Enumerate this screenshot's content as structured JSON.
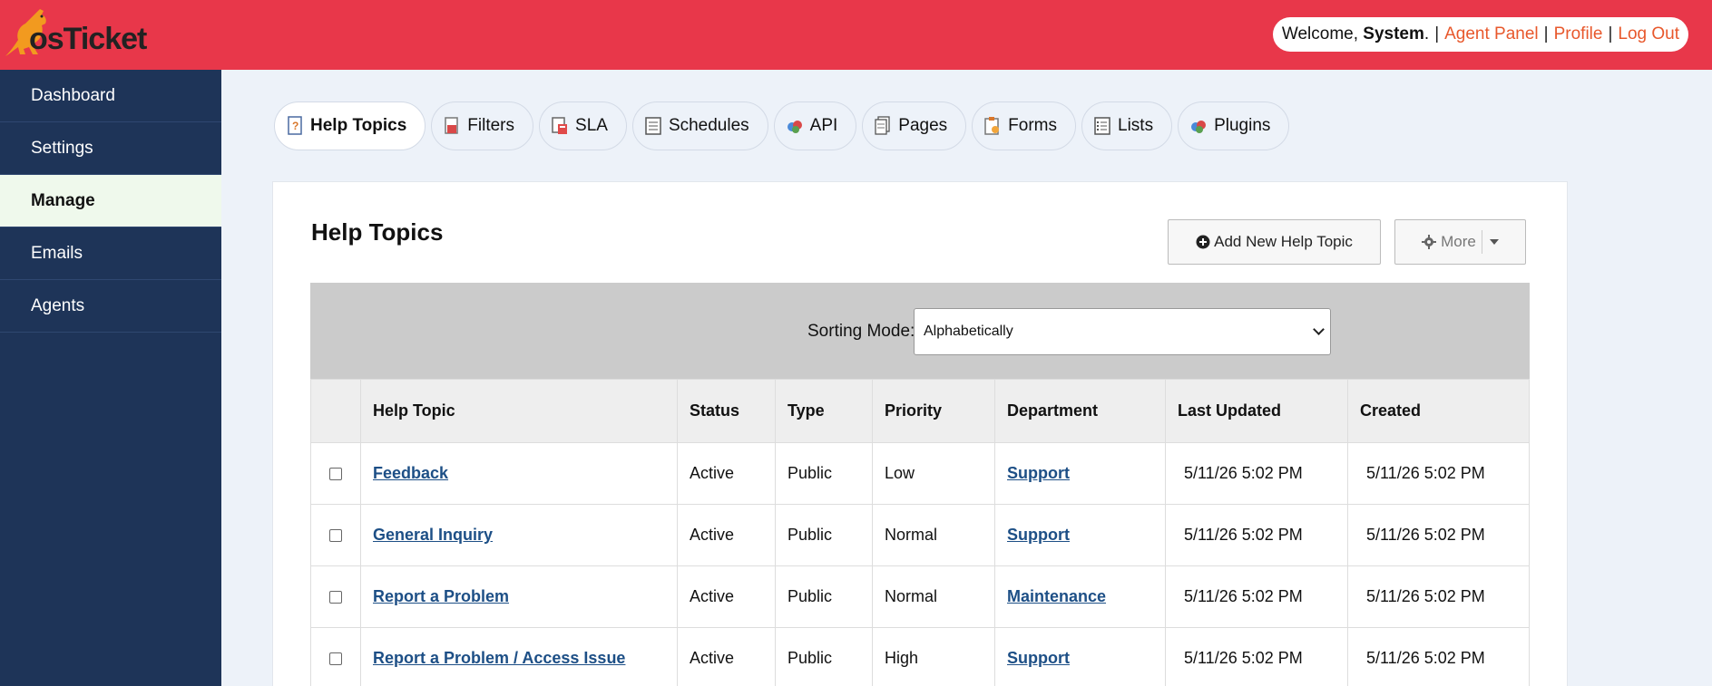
{
  "app": {
    "logo_text": "osTicket"
  },
  "header": {
    "welcome_prefix": "Welcome,",
    "user": "System",
    "welcome_suffix": ".",
    "sep": "|",
    "links": [
      "Agent Panel",
      "Profile",
      "Log Out"
    ]
  },
  "sidebar": {
    "items": [
      {
        "label": "Dashboard"
      },
      {
        "label": "Settings"
      },
      {
        "label": "Manage",
        "active": true
      },
      {
        "label": "Emails"
      },
      {
        "label": "Agents"
      }
    ]
  },
  "tabs": [
    {
      "label": "Help Topics",
      "icon": "help-topics-icon",
      "active": true
    },
    {
      "label": "Filters",
      "icon": "filters-icon"
    },
    {
      "label": "SLA",
      "icon": "sla-icon"
    },
    {
      "label": "Schedules",
      "icon": "schedules-icon"
    },
    {
      "label": "API",
      "icon": "api-icon"
    },
    {
      "label": "Pages",
      "icon": "pages-icon"
    },
    {
      "label": "Forms",
      "icon": "forms-icon"
    },
    {
      "label": "Lists",
      "icon": "lists-icon"
    },
    {
      "label": "Plugins",
      "icon": "plugins-icon"
    }
  ],
  "main": {
    "title": "Help Topics",
    "add_button": "Add New Help Topic",
    "more_button": "More",
    "sorting": {
      "label": "Sorting Mode:",
      "value": "Alphabetically"
    },
    "table": {
      "columns": [
        "Help Topic",
        "Status",
        "Type",
        "Priority",
        "Department",
        "Last Updated",
        "Created"
      ],
      "rows": [
        {
          "topic": "Feedback",
          "status": "Active",
          "type": "Public",
          "priority": "Low",
          "department": "Support",
          "updated": "5/11/26 5:02 PM",
          "created": "5/11/26 5:02 PM"
        },
        {
          "topic": "General Inquiry",
          "status": "Active",
          "type": "Public",
          "priority": "Normal",
          "department": "Support",
          "updated": "5/11/26 5:02 PM",
          "created": "5/11/26 5:02 PM"
        },
        {
          "topic": "Report a Problem",
          "status": "Active",
          "type": "Public",
          "priority": "Normal",
          "department": "Maintenance",
          "updated": "5/11/26 5:02 PM",
          "created": "5/11/26 5:02 PM"
        },
        {
          "topic": "Report a Problem / Access Issue",
          "status": "Active",
          "type": "Public",
          "priority": "High",
          "department": "Support",
          "updated": "5/11/26 5:02 PM",
          "created": "5/11/26 5:02 PM"
        }
      ]
    }
  },
  "colors": {
    "header_bg": "#e8374a",
    "sidebar_bg": "#1e3458",
    "link_orange": "#e8582c",
    "link_blue": "#1d4f86"
  }
}
